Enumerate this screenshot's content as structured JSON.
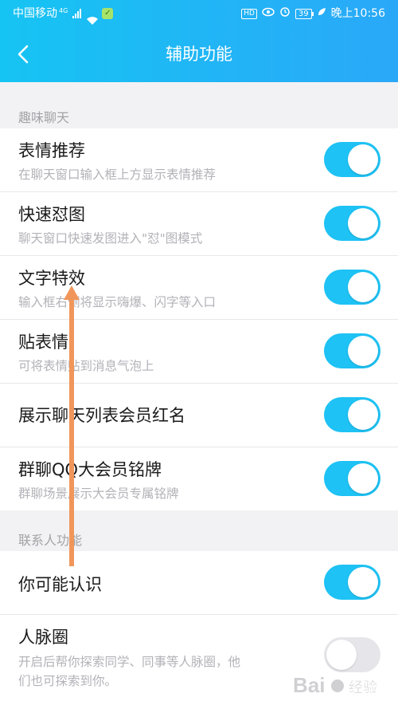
{
  "status_bar": {
    "carrier": "中国移动",
    "network": "4G",
    "battery": "39",
    "time_prefix": "晚上",
    "time": "10:56",
    "hd": "HD"
  },
  "navbar": {
    "title": "辅助功能"
  },
  "colors": {
    "accent": "#1ec2f4",
    "header_start": "#16c4f3",
    "header_end": "#2aa8f8",
    "arrow": "#f0965a"
  },
  "sections": [
    {
      "header": "趣味聊天",
      "items": [
        {
          "title": "表情推荐",
          "subtitle": "在聊天窗口输入框上方显示表情推荐",
          "enabled": true
        },
        {
          "title": "快速怼图",
          "subtitle": "聊天窗口快速发图进入\"怼\"图模式",
          "enabled": true
        },
        {
          "title": "文字特效",
          "subtitle": "输入框右侧将显示嗨爆、闪字等入口",
          "enabled": true
        },
        {
          "title": "贴表情",
          "subtitle": "可将表情贴到消息气泡上",
          "enabled": true
        },
        {
          "title": "展示聊天列表会员红名",
          "subtitle": "",
          "enabled": true
        },
        {
          "title": "群聊QQ大会员铭牌",
          "subtitle": "群聊场景展示大会员专属铭牌",
          "enabled": true
        }
      ]
    },
    {
      "header": "联系人功能",
      "items": [
        {
          "title": "你可能认识",
          "subtitle": "",
          "enabled": true
        },
        {
          "title": "人脉圈",
          "subtitle_lines": [
            "开启后帮你探索同学、同事等人脉圈，他",
            "们也可探索到你。"
          ],
          "enabled": false
        }
      ]
    }
  ],
  "watermark": {
    "text": "Bai",
    "text2": "经验"
  }
}
